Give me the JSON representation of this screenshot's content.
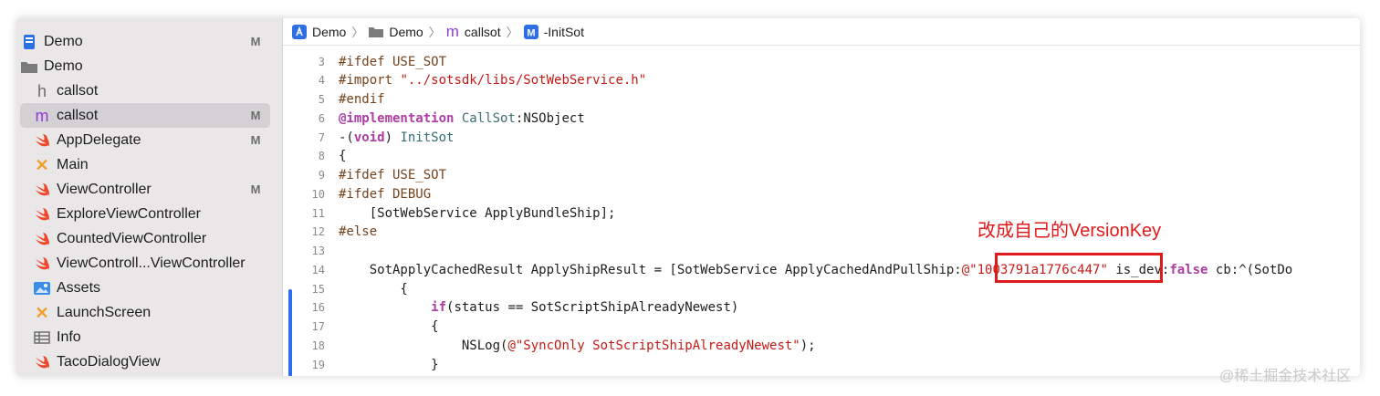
{
  "sidebar": {
    "items": [
      {
        "label": "Demo",
        "icon": "app-project-icon",
        "badge": "M"
      },
      {
        "label": "Demo",
        "icon": "folder-icon",
        "badge": ""
      },
      {
        "label": "callsot",
        "icon": "header-file-icon",
        "badge": ""
      },
      {
        "label": "callsot",
        "icon": "objc-file-icon",
        "badge": "M"
      },
      {
        "label": "AppDelegate",
        "icon": "swift-file-icon",
        "badge": "M"
      },
      {
        "label": "Main",
        "icon": "storyboard-icon",
        "badge": ""
      },
      {
        "label": "ViewController",
        "icon": "swift-file-icon",
        "badge": "M"
      },
      {
        "label": "ExploreViewController",
        "icon": "swift-file-icon",
        "badge": ""
      },
      {
        "label": "CountedViewController",
        "icon": "swift-file-icon",
        "badge": ""
      },
      {
        "label": "ViewControll...ViewController",
        "icon": "swift-file-icon",
        "badge": ""
      },
      {
        "label": "Assets",
        "icon": "asset-catalog-icon",
        "badge": ""
      },
      {
        "label": "LaunchScreen",
        "icon": "storyboard-icon",
        "badge": ""
      },
      {
        "label": "Info",
        "icon": "plist-table-icon",
        "badge": ""
      },
      {
        "label": "TacoDialogView",
        "icon": "swift-file-icon",
        "badge": ""
      }
    ]
  },
  "breadcrumb": {
    "items": [
      "Demo",
      "Demo",
      "callsot",
      "-InitSot"
    ]
  },
  "code": {
    "lines": [
      {
        "n": "3",
        "html": "<span class=\"k-pre\">#ifdef USE_SOT</span>"
      },
      {
        "n": "4",
        "html": "<span class=\"k-pre\">#import </span><span class=\"k-str\">\"../sotsdk/libs/SotWebService.h\"</span>"
      },
      {
        "n": "5",
        "html": "<span class=\"k-pre\">#endif</span>"
      },
      {
        "n": "6",
        "html": "<span class=\"k-kw\">@implementation</span> <span class=\"k-cls\">CallSot</span>:NSObject"
      },
      {
        "n": "7",
        "html": "-(<span class=\"k-kw\">void</span>) <span class=\"k-fn\">InitSot</span>"
      },
      {
        "n": "8",
        "html": "{"
      },
      {
        "n": "9",
        "html": "<span class=\"k-pre\">#ifdef USE_SOT</span>"
      },
      {
        "n": "10",
        "html": "<span class=\"k-pre\">#ifdef DEBUG</span>"
      },
      {
        "n": "11",
        "html": "    [SotWebService ApplyBundleShip];"
      },
      {
        "n": "12",
        "html": "<span class=\"k-pre\">#else</span>"
      },
      {
        "n": "13",
        "html": ""
      },
      {
        "n": "14",
        "html": "    SotApplyCachedResult ApplyShipResult = [SotWebService ApplyCachedAndPullShip:<span class=\"k-str\">@\"1003791a1776c447\"</span> is_dev:<span class=\"k-kw\">false</span> cb:^(SotDo"
      },
      {
        "n": "15",
        "html": "        {"
      },
      {
        "n": "16",
        "html": "            <span class=\"k-kw\">if</span>(status == SotScriptShipAlreadyNewest)"
      },
      {
        "n": "17",
        "html": "            {"
      },
      {
        "n": "18",
        "html": "                NSLog(<span class=\"k-str\">@\"SyncOnly SotScriptShipAlreadyNewest\"</span>);"
      },
      {
        "n": "19",
        "html": "            }"
      }
    ]
  },
  "annotation": {
    "text": "改成自己的VersionKey",
    "color": "#e01a1a"
  },
  "watermark": "@稀土掘金技术社区"
}
